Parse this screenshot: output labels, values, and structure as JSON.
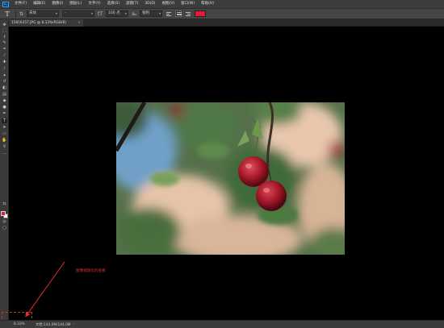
{
  "app": {
    "logo": "Ps"
  },
  "menu": [
    "文件(F)",
    "编辑(E)",
    "图像(I)",
    "图层(L)",
    "文字(Y)",
    "选择(S)",
    "滤镜(T)",
    "3D(D)",
    "视图(V)",
    "窗口(W)",
    "帮助(H)"
  ],
  "options": {
    "tool_glyph": "T",
    "orientation_glyph": "⇅",
    "font_family": "宋体",
    "font_style": "-",
    "size_glyph": "tT",
    "font_size": "100 点",
    "aa_glyph": "aₐ",
    "antialias": "锐利",
    "text_color": "#e3193a"
  },
  "tab": {
    "label": "15816357.JPG @ 8.33%(RGB/8)",
    "close": "×"
  },
  "tools": [
    {
      "name": "move-tool-icon",
      "glyph": "✥"
    },
    {
      "name": "marquee-tool-icon",
      "glyph": "⬚"
    },
    {
      "name": "lasso-tool-icon",
      "glyph": "ℓ"
    },
    {
      "name": "quick-select-tool-icon",
      "glyph": "✎"
    },
    {
      "name": "crop-tool-icon",
      "glyph": "⌗"
    },
    {
      "name": "eyedropper-tool-icon",
      "glyph": "⁄"
    },
    {
      "name": "healing-tool-icon",
      "glyph": "✚"
    },
    {
      "name": "brush-tool-icon",
      "glyph": "∕"
    },
    {
      "name": "stamp-tool-icon",
      "glyph": "▴"
    },
    {
      "name": "history-brush-tool-icon",
      "glyph": "↺"
    },
    {
      "name": "eraser-tool-icon",
      "glyph": "◧"
    },
    {
      "name": "gradient-tool-icon",
      "glyph": "▤"
    },
    {
      "name": "blur-tool-icon",
      "glyph": "◆"
    },
    {
      "name": "dodge-tool-icon",
      "glyph": "●"
    },
    {
      "name": "pen-tool-icon",
      "glyph": "✒"
    },
    {
      "name": "type-tool-icon",
      "glyph": "T"
    },
    {
      "name": "path-select-tool-icon",
      "glyph": "➤"
    },
    {
      "name": "shape-tool-icon",
      "glyph": "▭"
    },
    {
      "name": "hand-tool-icon",
      "glyph": "✋"
    },
    {
      "name": "zoom-tool-icon",
      "glyph": "⚲"
    },
    {
      "name": "more-tools-icon",
      "glyph": "…"
    },
    {
      "name": "swap-colors-icon",
      "glyph": "⇆"
    },
    {
      "name": "quick-mask-icon",
      "glyph": "◎"
    },
    {
      "name": "screen-mode-icon",
      "glyph": "▢"
    }
  ],
  "colors": {
    "foreground": "#e31b3b",
    "background": "#ffffff"
  },
  "annotation": {
    "text": "图像缩放比的查看"
  },
  "status": {
    "zoom": "8.33%",
    "doc": "文档:144.0M/144.0M",
    "arrow": "›"
  }
}
